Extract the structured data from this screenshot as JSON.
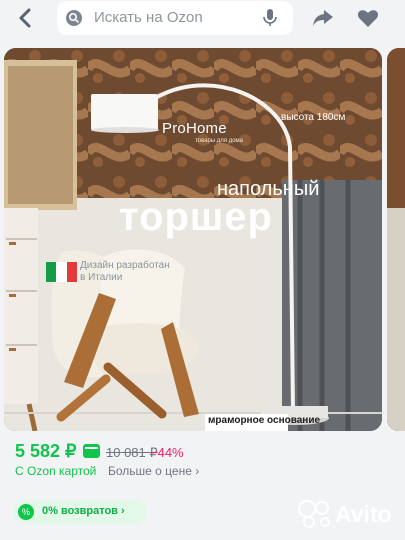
{
  "search": {
    "placeholder": "Искать на Ozon"
  },
  "product": {
    "brand": "ProHome",
    "brand_sub": "товары для дома",
    "height_label": "высота 180см",
    "subtitle": "напольный",
    "title": "торшер",
    "design_text": "Дизайн разработан в Италии",
    "base_text": "мраморное основание"
  },
  "pricing": {
    "price": "5 582 ₽",
    "old_price": "10 081 ₽",
    "discount": "−44%",
    "ozon_card": "С Ozon картой",
    "more": "Больше о цене ›"
  },
  "returns": {
    "label": "0% возвратов ›"
  },
  "watermark": {
    "text": "Avito"
  },
  "colors": {
    "accent": "#10c44c",
    "discount": "#f51b6b",
    "muted": "#6f7682"
  },
  "icons": [
    "back-arrow-icon",
    "search-icon",
    "microphone-icon",
    "share-icon",
    "heart-icon",
    "visual-search-icon",
    "return-percent-icon",
    "avito-logo-icon"
  ]
}
